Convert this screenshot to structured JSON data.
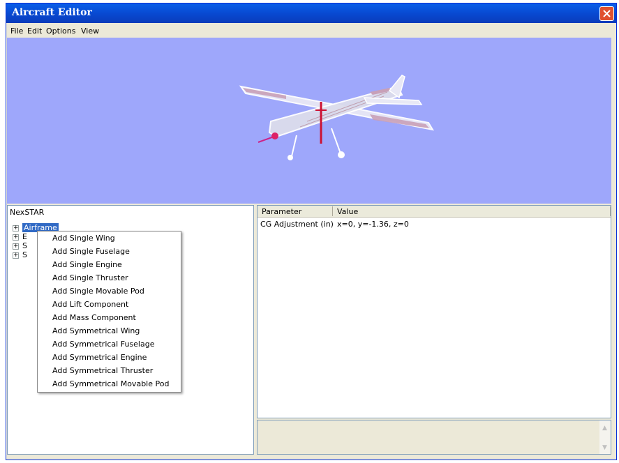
{
  "window": {
    "title": "Aircraft Editor"
  },
  "menu": [
    "File",
    "Edit",
    "Options",
    "View"
  ],
  "tree": {
    "root": "NexSTAR",
    "nodes": [
      {
        "label": "Airframe",
        "selected": true
      },
      {
        "label": "E",
        "selected": false
      },
      {
        "label": "S",
        "selected": false
      },
      {
        "label": "S",
        "selected": false
      }
    ]
  },
  "context_menu": {
    "items": [
      "Add Single Wing",
      "Add Single Fuselage",
      "Add Single Engine",
      "Add Single Thruster",
      "Add Single Movable Pod",
      "Add Lift Component",
      "Add Mass Component",
      "Add Symmetrical Wing",
      "Add Symmetrical Fuselage",
      "Add Symmetrical Engine",
      "Add Symmetrical Thruster",
      "Add Symmetrical Movable Pod"
    ]
  },
  "grid": {
    "columns": [
      "Parameter",
      "Value"
    ],
    "rows": [
      {
        "parameter": "CG Adjustment (in)",
        "value": "x=0, y=-1.36, z=0"
      }
    ]
  },
  "colors": {
    "titlebar": "#0a5fe8",
    "viewport_background": "#9ea7fb",
    "selection": "#316ac5",
    "close_button": "#e0512f"
  },
  "icons": [
    "close-icon",
    "expand-plus-icon",
    "scroll-up-arrow-icon",
    "scroll-down-arrow-icon"
  ]
}
